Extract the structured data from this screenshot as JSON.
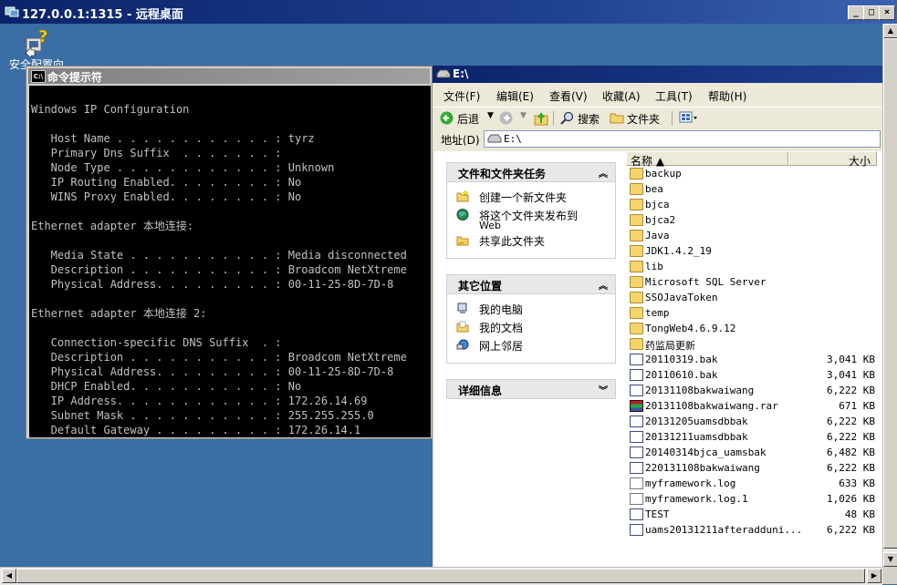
{
  "rdp": {
    "title": "127.0.0.1:1315 - 远程桌面",
    "min": "_",
    "max": "□",
    "close": "×"
  },
  "desktop": {
    "icon_label": "安全配置向"
  },
  "cmd": {
    "title": "命令提示符",
    "lines": [
      "",
      "Windows IP Configuration",
      "",
      "   Host Name . . . . . . . . . . . . : tyrz",
      "   Primary Dns Suffix  . . . . . . . :",
      "   Node Type . . . . . . . . . . . . : Unknown",
      "   IP Routing Enabled. . . . . . . . : No",
      "   WINS Proxy Enabled. . . . . . . . : No",
      "",
      "Ethernet adapter 本地连接:",
      "",
      "   Media State . . . . . . . . . . . : Media disconnected",
      "   Description . . . . . . . . . . . : Broadcom NetXtreme",
      "   Physical Address. . . . . . . . . : 00-11-25-8D-7D-8",
      "",
      "Ethernet adapter 本地连接 2:",
      "",
      "   Connection-specific DNS Suffix  . :",
      "   Description . . . . . . . . . . . : Broadcom NetXtreme",
      "   Physical Address. . . . . . . . . : 00-11-25-8D-7D-8",
      "   DHCP Enabled. . . . . . . . . . . : No",
      "   IP Address. . . . . . . . . . . . : 172.26.14.69",
      "   Subnet Mask . . . . . . . . . . . : 255.255.255.0",
      "   Default Gateway . . . . . . . . . : 172.26.14.1"
    ]
  },
  "explorer": {
    "title": "E:\\",
    "menu": [
      "文件(F)",
      "编辑(E)",
      "查看(V)",
      "收藏(A)",
      "工具(T)",
      "帮助(H)"
    ],
    "toolbar": {
      "back": "后退",
      "search": "搜索",
      "folders": "文件夹"
    },
    "address": {
      "label": "地址(D)",
      "value": "E:\\"
    },
    "tasks": {
      "header": "文件和文件夹任务",
      "items": [
        "创建一个新文件夹",
        "将这个文件夹发布到",
        "Web",
        "共享此文件夹"
      ]
    },
    "places": {
      "header": "其它位置",
      "items": [
        "我的电脑",
        "我的文档",
        "网上邻居"
      ]
    },
    "details": {
      "header": "详细信息"
    },
    "columns": {
      "name": "名称 ▲",
      "size": "大小"
    },
    "files": [
      {
        "name": "backup",
        "size": "",
        "type": "folder"
      },
      {
        "name": "bea",
        "size": "",
        "type": "folder"
      },
      {
        "name": "bjca",
        "size": "",
        "type": "folder"
      },
      {
        "name": "bjca2",
        "size": "",
        "type": "folder"
      },
      {
        "name": "Java",
        "size": "",
        "type": "folder"
      },
      {
        "name": "JDK1.4.2_19",
        "size": "",
        "type": "folder"
      },
      {
        "name": "lib",
        "size": "",
        "type": "folder"
      },
      {
        "name": "Microsoft SQL Server",
        "size": "",
        "type": "folder"
      },
      {
        "name": "SSOJavaToken",
        "size": "",
        "type": "folder"
      },
      {
        "name": "temp",
        "size": "",
        "type": "folder"
      },
      {
        "name": "TongWeb4.6.9.12",
        "size": "",
        "type": "folder"
      },
      {
        "name": "药监局更新",
        "size": "",
        "type": "folder"
      },
      {
        "name": "20110319.bak",
        "size": "3,041 KB",
        "type": "file"
      },
      {
        "name": "20110610.bak",
        "size": "3,041 KB",
        "type": "file"
      },
      {
        "name": "20131108bakwaiwang",
        "size": "6,222 KB",
        "type": "file"
      },
      {
        "name": "20131108bakwaiwang.rar",
        "size": "671 KB",
        "type": "rar"
      },
      {
        "name": "20131205uamsdbbak",
        "size": "6,222 KB",
        "type": "file"
      },
      {
        "name": "20131211uamsdbbak",
        "size": "6,222 KB",
        "type": "file"
      },
      {
        "name": "20140314bjca_uamsbak",
        "size": "6,482 KB",
        "type": "file"
      },
      {
        "name": "220131108bakwaiwang",
        "size": "6,222 KB",
        "type": "file"
      },
      {
        "name": "myframework.log",
        "size": "633 KB",
        "type": "log"
      },
      {
        "name": "myframework.log.1",
        "size": "1,026 KB",
        "type": "log"
      },
      {
        "name": "TEST",
        "size": "48 KB",
        "type": "file"
      },
      {
        "name": "uams20131211afteradduni...",
        "size": "6,222 KB",
        "type": "file"
      }
    ]
  }
}
